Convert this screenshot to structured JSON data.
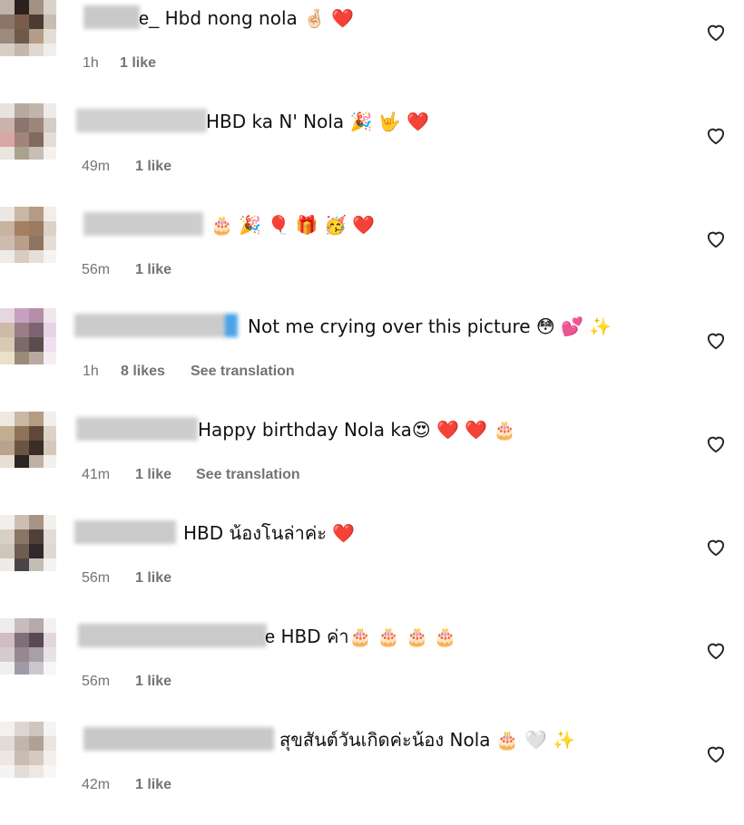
{
  "comments": [
    {
      "user_visible": "e_",
      "text": " Hbd nong nola 🤞🏻 ❤️",
      "time": "1h",
      "likes": "1 like",
      "translation": ""
    },
    {
      "user_visible": "",
      "text": "HBD ka N' Nola 🎉 🤟 ❤️",
      "time": "49m",
      "likes": "1 like",
      "translation": ""
    },
    {
      "user_visible": "",
      "text": "🎂 🎉 🎈 🎁 🥳 ❤️",
      "time": "56m",
      "likes": "1 like",
      "translation": ""
    },
    {
      "user_visible": "",
      "text": "Not me crying over this picture 😳 💕 ✨",
      "time": "1h",
      "likes": "8 likes",
      "translation": "See translation"
    },
    {
      "user_visible": "",
      "text": "Happy birthday Nola ka😍 ❤️ ❤️  🎂",
      "time": "41m",
      "likes": "1 like",
      "translation": "See translation"
    },
    {
      "user_visible": "",
      "text": "HBD น้องโนล่าค่ะ ❤️",
      "time": "56m",
      "likes": "1 like",
      "translation": ""
    },
    {
      "user_visible": "e",
      "text": " HBD ค่า🎂 🎂 🎂 🎂",
      "time": "56m",
      "likes": "1 like",
      "translation": ""
    },
    {
      "user_visible": "",
      "text": "สุขสันต์วันเกิดค่ะน้อง Nola 🎂 🤍 ✨",
      "time": "42m",
      "likes": "1 like",
      "translation": ""
    }
  ],
  "colors": {
    "meta": "#737373",
    "text": "#111111"
  },
  "icons": {
    "like": "heart-outline-icon"
  }
}
